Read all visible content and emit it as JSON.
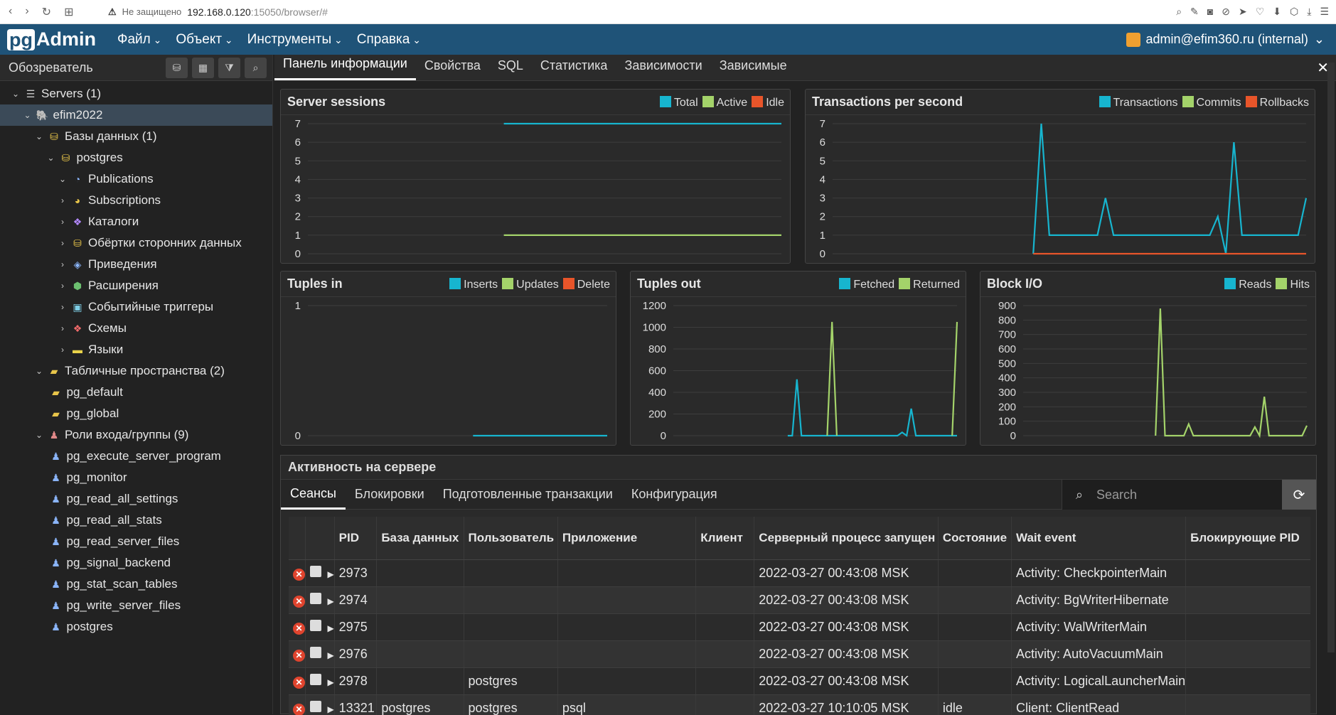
{
  "browser": {
    "insecure": "Не защищено",
    "host": "192.168.0.120",
    "path": ":15050/browser/#"
  },
  "app": {
    "logo_pg": "pg",
    "logo_admin": "Admin",
    "menus": [
      "Файл",
      "Объект",
      "Инструменты",
      "Справка"
    ],
    "user": "admin@efim360.ru (internal)"
  },
  "sidebar": {
    "title": "Обозреватель",
    "tree": [
      {
        "label": "Servers (1)",
        "level": 0,
        "toggle": "⌄",
        "icon": "server-icon"
      },
      {
        "label": "efim2022",
        "level": 1,
        "toggle": "⌄",
        "icon": "elephant-icon",
        "selected": true
      },
      {
        "label": "Базы данных (1)",
        "level": 2,
        "toggle": "⌄",
        "icon": "databases-icon"
      },
      {
        "label": "postgres",
        "level": 3,
        "toggle": "⌄",
        "icon": "database-icon"
      },
      {
        "label": "Publications",
        "level": 4,
        "toggle": "⌄",
        "icon": "publication-icon"
      },
      {
        "label": "Subscriptions",
        "level": 4,
        "toggle": "›",
        "icon": "subscription-icon"
      },
      {
        "label": "Каталоги",
        "level": 4,
        "toggle": "›",
        "icon": "catalog-icon"
      },
      {
        "label": "Обёртки сторонних данных",
        "level": 4,
        "toggle": "›",
        "icon": "fdw-icon"
      },
      {
        "label": "Приведения",
        "level": 4,
        "toggle": "›",
        "icon": "cast-icon"
      },
      {
        "label": "Расширения",
        "level": 4,
        "toggle": "›",
        "icon": "extension-icon"
      },
      {
        "label": "Событийные триггеры",
        "level": 4,
        "toggle": "›",
        "icon": "event-trigger-icon"
      },
      {
        "label": "Схемы",
        "level": 4,
        "toggle": "›",
        "icon": "schema-icon"
      },
      {
        "label": "Языки",
        "level": 4,
        "toggle": "›",
        "icon": "language-icon"
      },
      {
        "label": "Табличные пространства (2)",
        "level": 2,
        "toggle": "⌄",
        "icon": "tablespaces-icon"
      },
      {
        "label": "pg_default",
        "level": 3,
        "toggle": "",
        "icon": "folder-icon"
      },
      {
        "label": "pg_global",
        "level": 3,
        "toggle": "",
        "icon": "folder-icon"
      },
      {
        "label": "Роли входа/группы (9)",
        "level": 2,
        "toggle": "⌄",
        "icon": "roles-icon"
      },
      {
        "label": "pg_execute_server_program",
        "level": 3,
        "toggle": "",
        "icon": "group-role-icon"
      },
      {
        "label": "pg_monitor",
        "level": 3,
        "toggle": "",
        "icon": "group-role-icon"
      },
      {
        "label": "pg_read_all_settings",
        "level": 3,
        "toggle": "",
        "icon": "group-role-icon"
      },
      {
        "label": "pg_read_all_stats",
        "level": 3,
        "toggle": "",
        "icon": "group-role-icon"
      },
      {
        "label": "pg_read_server_files",
        "level": 3,
        "toggle": "",
        "icon": "group-role-icon"
      },
      {
        "label": "pg_signal_backend",
        "level": 3,
        "toggle": "",
        "icon": "group-role-icon"
      },
      {
        "label": "pg_stat_scan_tables",
        "level": 3,
        "toggle": "",
        "icon": "group-role-icon"
      },
      {
        "label": "pg_write_server_files",
        "level": 3,
        "toggle": "",
        "icon": "group-role-icon"
      },
      {
        "label": "postgres",
        "level": 3,
        "toggle": "",
        "icon": "user-role-icon"
      }
    ]
  },
  "tabs": [
    "Панель информации",
    "Свойства",
    "SQL",
    "Статистика",
    "Зависимости",
    "Зависимые"
  ],
  "colors": {
    "blue": "#17b5cf",
    "green": "#a4d36a",
    "orange": "#e8552a"
  },
  "chart_data": [
    {
      "id": "sessions",
      "type": "line",
      "title": "Server sessions",
      "ylim": [
        0,
        7
      ],
      "yticks": [
        0,
        1,
        2,
        3,
        4,
        5,
        6,
        7
      ],
      "n": 30,
      "series": [
        {
          "name": "Total",
          "color": "#17b5cf",
          "values": [
            null,
            null,
            null,
            null,
            null,
            null,
            null,
            null,
            null,
            null,
            null,
            null,
            7,
            7,
            7,
            7,
            7,
            7,
            7,
            7,
            7,
            7,
            7,
            7,
            7,
            7,
            7,
            7,
            7,
            7
          ]
        },
        {
          "name": "Active",
          "color": "#a4d36a",
          "values": [
            null,
            null,
            null,
            null,
            null,
            null,
            null,
            null,
            null,
            null,
            null,
            null,
            1,
            1,
            1,
            1,
            1,
            1,
            1,
            1,
            1,
            1,
            1,
            1,
            1,
            1,
            1,
            1,
            1,
            1
          ]
        },
        {
          "name": "Idle",
          "color": "#e8552a",
          "values": []
        }
      ]
    },
    {
      "id": "tps",
      "type": "line",
      "title": "Transactions per second",
      "ylim": [
        0,
        7
      ],
      "yticks": [
        0,
        1,
        2,
        3,
        4,
        5,
        6,
        7
      ],
      "n": 50,
      "series": [
        {
          "name": "Transactions",
          "color": "#17b5cf",
          "values": [
            null,
            null,
            null,
            null,
            null,
            null,
            null,
            null,
            null,
            null,
            null,
            null,
            null,
            null,
            null,
            null,
            null,
            null,
            null,
            null,
            null,
            null,
            null,
            null,
            null,
            0,
            7,
            1,
            1,
            1,
            1,
            1,
            1,
            1,
            3,
            1,
            1,
            1,
            1,
            1,
            1,
            1,
            1,
            1,
            1,
            1,
            1,
            1,
            2,
            0,
            6,
            1,
            1,
            1,
            1,
            1,
            1,
            1,
            1,
            3
          ]
        },
        {
          "name": "Commits",
          "color": "#a4d36a",
          "values": []
        },
        {
          "name": "Rollbacks",
          "color": "#e8552a",
          "values": [
            null,
            null,
            null,
            null,
            null,
            null,
            null,
            null,
            null,
            null,
            null,
            null,
            null,
            null,
            null,
            null,
            null,
            null,
            null,
            null,
            null,
            null,
            null,
            null,
            null,
            0,
            0,
            0,
            0,
            0,
            0,
            0,
            0,
            0,
            0,
            0,
            0,
            0,
            0,
            0,
            0,
            0,
            0,
            0,
            0,
            0,
            0,
            0,
            0,
            0,
            0,
            0,
            0,
            0,
            0,
            0,
            0,
            0,
            0,
            0
          ]
        }
      ]
    },
    {
      "id": "tin",
      "type": "line",
      "title": "Tuples in",
      "ylim": [
        0,
        1
      ],
      "yticks": [
        0,
        1
      ],
      "n": 30,
      "series": [
        {
          "name": "Inserts",
          "color": "#17b5cf",
          "values": [
            null,
            null,
            null,
            null,
            null,
            null,
            null,
            null,
            null,
            null,
            null,
            null,
            null,
            null,
            null,
            null,
            0,
            0,
            0,
            0,
            0,
            0,
            0,
            0,
            0,
            0,
            0,
            0,
            0,
            0
          ]
        },
        {
          "name": "Updates",
          "color": "#a4d36a",
          "values": []
        },
        {
          "name": "Delete",
          "color": "#e8552a",
          "values": []
        }
      ]
    },
    {
      "id": "tout",
      "type": "line",
      "title": "Tuples out",
      "ylim": [
        0,
        1200
      ],
      "yticks": [
        0,
        200,
        400,
        600,
        800,
        1000,
        1200
      ],
      "n": 60,
      "series": [
        {
          "name": "Fetched",
          "color": "#17b5cf",
          "values": [
            null,
            null,
            null,
            null,
            null,
            null,
            null,
            null,
            null,
            null,
            null,
            null,
            null,
            null,
            null,
            null,
            null,
            null,
            null,
            null,
            null,
            null,
            null,
            null,
            null,
            0,
            0,
            520,
            0,
            0,
            0,
            0,
            0,
            0,
            0,
            0,
            0,
            0,
            0,
            0,
            0,
            0,
            0,
            0,
            0,
            0,
            0,
            0,
            0,
            0,
            30,
            0,
            250,
            0,
            0,
            0,
            0,
            0,
            0,
            0,
            0,
            0,
            0
          ]
        },
        {
          "name": "Returned",
          "color": "#a4d36a",
          "values": [
            null,
            null,
            null,
            null,
            null,
            null,
            null,
            null,
            null,
            null,
            null,
            null,
            null,
            null,
            null,
            null,
            null,
            null,
            null,
            null,
            null,
            null,
            null,
            null,
            null,
            null,
            null,
            null,
            null,
            null,
            null,
            null,
            0,
            1050,
            0,
            null,
            null,
            null,
            null,
            null,
            null,
            null,
            null,
            null,
            null,
            null,
            null,
            null,
            null,
            null,
            null,
            null,
            null,
            null,
            null,
            null,
            null,
            null,
            0,
            1050
          ]
        }
      ]
    },
    {
      "id": "bio",
      "type": "line",
      "title": "Block I/O",
      "ylim": [
        0,
        900
      ],
      "yticks": [
        0,
        100,
        200,
        300,
        400,
        500,
        600,
        700,
        800,
        900
      ],
      "n": 60,
      "series": [
        {
          "name": "Reads",
          "color": "#17b5cf",
          "values": []
        },
        {
          "name": "Hits",
          "color": "#a4d36a",
          "values": [
            null,
            null,
            null,
            null,
            null,
            null,
            null,
            null,
            null,
            null,
            null,
            null,
            null,
            null,
            null,
            null,
            null,
            null,
            null,
            null,
            null,
            null,
            null,
            null,
            null,
            null,
            null,
            null,
            0,
            880,
            0,
            0,
            0,
            0,
            0,
            80,
            0,
            0,
            0,
            0,
            0,
            0,
            0,
            0,
            0,
            0,
            0,
            0,
            0,
            60,
            0,
            270,
            0,
            0,
            0,
            0,
            0,
            0,
            0,
            0,
            70
          ]
        }
      ]
    }
  ],
  "activity": {
    "title": "Активность на сервере",
    "tabs": [
      "Сеансы",
      "Блокировки",
      "Подготовленные транзакции",
      "Конфигурация"
    ],
    "search_placeholder": "Search",
    "columns": [
      "PID",
      "База данных",
      "Пользователь",
      "Приложение",
      "Клиент",
      "Серверный процесс запущен",
      "Состояние",
      "Wait event",
      "Блокирующие PID"
    ],
    "rows": [
      [
        "2973",
        "",
        "",
        "",
        "",
        "2022-03-27 00:43:08 MSK",
        "",
        "Activity: CheckpointerMain",
        ""
      ],
      [
        "2974",
        "",
        "",
        "",
        "",
        "2022-03-27 00:43:08 MSK",
        "",
        "Activity: BgWriterHibernate",
        ""
      ],
      [
        "2975",
        "",
        "",
        "",
        "",
        "2022-03-27 00:43:08 MSK",
        "",
        "Activity: WalWriterMain",
        ""
      ],
      [
        "2976",
        "",
        "",
        "",
        "",
        "2022-03-27 00:43:08 MSK",
        "",
        "Activity: AutoVacuumMain",
        ""
      ],
      [
        "2978",
        "",
        "postgres",
        "",
        "",
        "2022-03-27 00:43:08 MSK",
        "",
        "Activity: LogicalLauncherMain",
        ""
      ],
      [
        "13321",
        "postgres",
        "postgres",
        "psql",
        "",
        "2022-03-27 10:10:05 MSK",
        "idle",
        "Client: ClientRead",
        ""
      ]
    ]
  }
}
